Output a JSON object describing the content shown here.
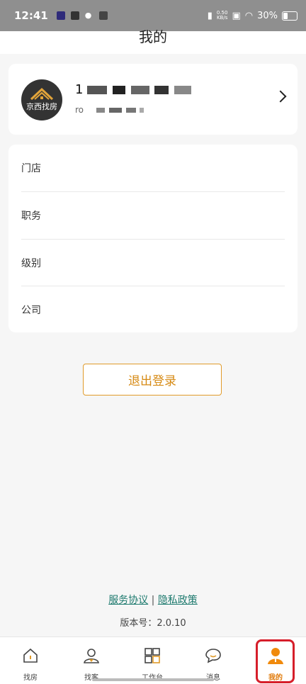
{
  "status_bar": {
    "time": "12:41",
    "net_speed_value": "0.50",
    "net_speed_unit": "KB/s",
    "battery": "30%"
  },
  "header": {
    "title": "我的"
  },
  "profile": {
    "avatar_text": "京西找房",
    "name_prefix": "1",
    "sub_prefix": "ro"
  },
  "info_items": [
    "门店",
    "职务",
    "级别",
    "公司"
  ],
  "logout_label": "退出登录",
  "footer": {
    "service_agreement": "服务协议",
    "separator": "|",
    "privacy_policy": "隐私政策",
    "version": "版本号：2.0.10"
  },
  "nav": {
    "items": [
      "找房",
      "找客",
      "工作台",
      "消息",
      "我的"
    ],
    "active_index": 4
  },
  "colors": {
    "accent": "#e09b2a",
    "active_nav": "#e07a0a",
    "link": "#1d7a6e",
    "highlight_outline": "#d61e2a"
  }
}
